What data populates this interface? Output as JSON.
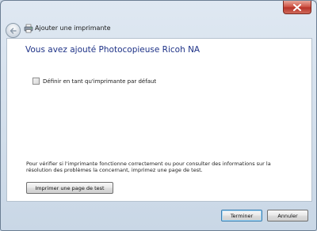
{
  "window": {
    "title": "Ajouter une imprimante"
  },
  "main": {
    "heading": "Vous avez ajouté Photocopieuse Ricoh NA",
    "default_checkbox_label": "Définir en tant qu'imprimante par défaut",
    "default_checkbox_checked": false,
    "info_text": "Pour vérifier si l'imprimante fonctionne correctement ou pour consulter des informations sur la résolution des problèmes la concernant, imprimez une page de test.",
    "test_button_label": "Imprimer une page de test"
  },
  "footer": {
    "finish_label": "Terminer",
    "cancel_label": "Annuler"
  },
  "colors": {
    "heading": "#1e3287",
    "close_button": "#c7473a"
  }
}
